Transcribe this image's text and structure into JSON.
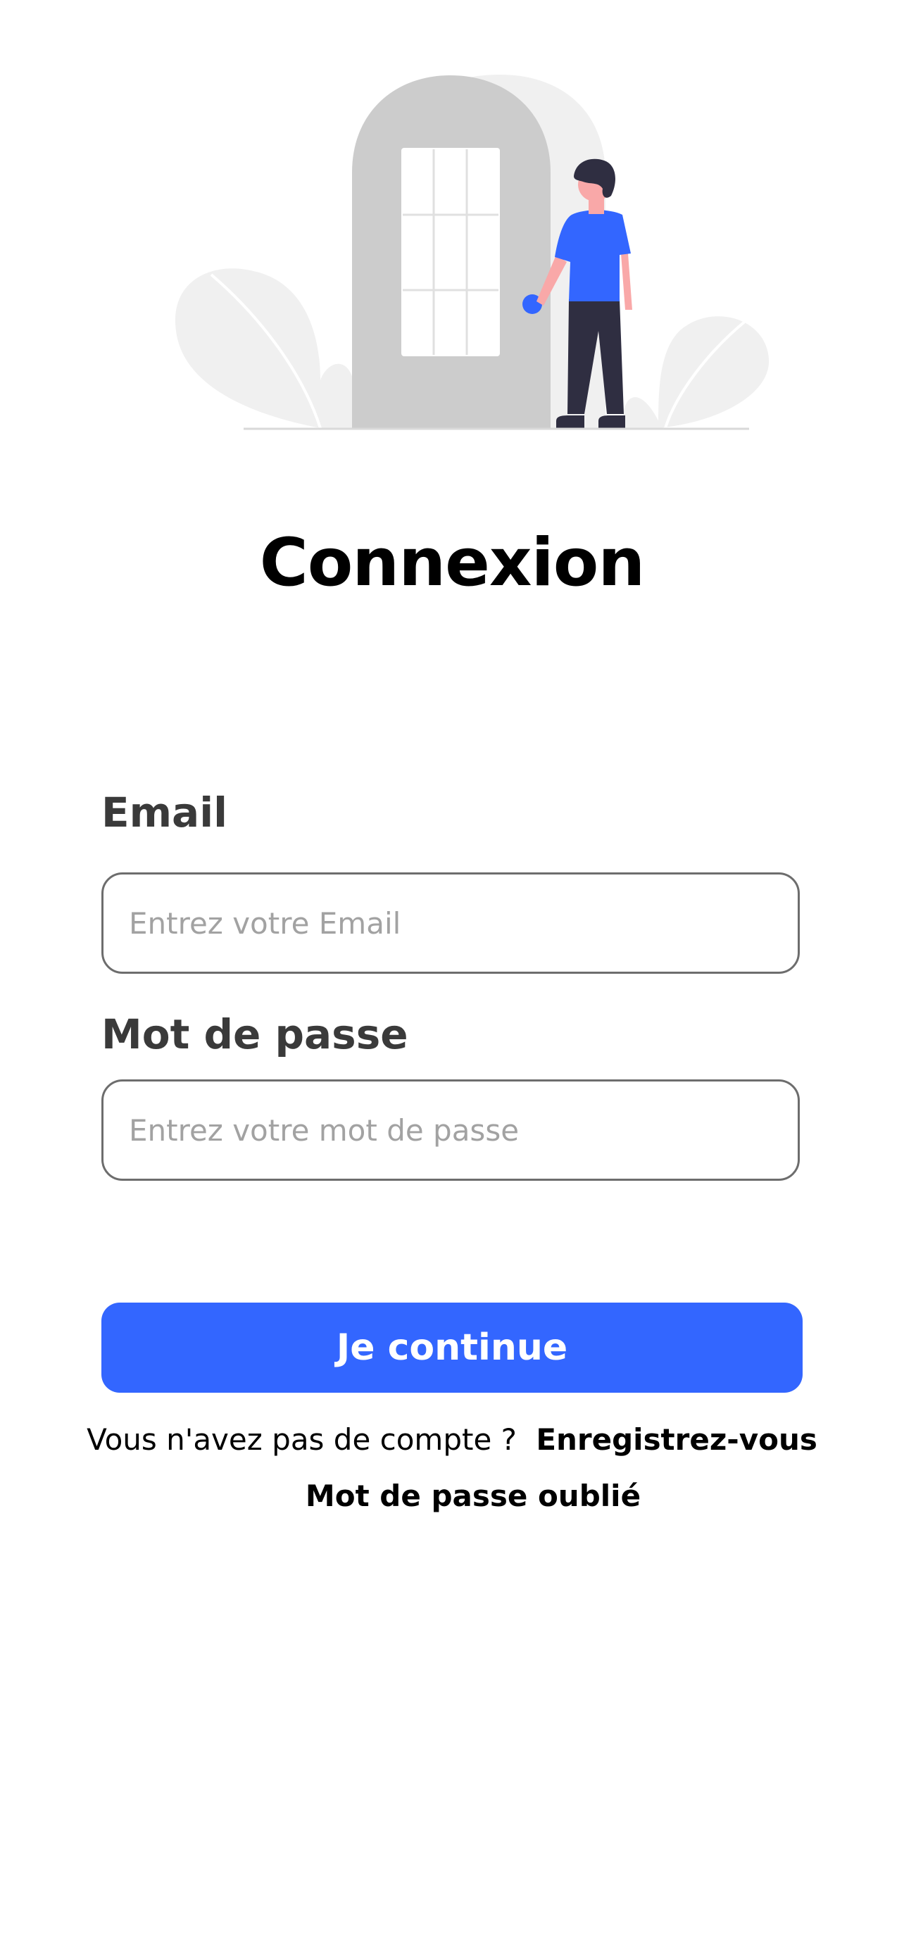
{
  "illustration": {
    "name": "login-door-illustration",
    "colors": {
      "door": "#cccccc",
      "door_shadow": "#f0f0f0",
      "plant": "#f0f0f0",
      "shirt": "#3366ff",
      "pants": "#2f2e41",
      "skin": "#f9a8a8",
      "hair": "#2f2e41"
    }
  },
  "page": {
    "title": "Connexion"
  },
  "form": {
    "email": {
      "label": "Email",
      "value": "",
      "placeholder": "Entrez votre Email"
    },
    "password": {
      "label": "Mot de passe",
      "value": "",
      "placeholder": "Entrez votre mot de passe"
    },
    "submit_label": "Je continue"
  },
  "footer": {
    "no_account_text": "Vous n'avez pas de compte ?",
    "register_link": "Enregistrez-vous",
    "forgot_link": "Mot de passe oublié"
  },
  "colors": {
    "accent": "#3366ff",
    "label_text": "#3a3a3a",
    "field_border": "#6d6d6d",
    "placeholder": "#a2a2a2"
  }
}
